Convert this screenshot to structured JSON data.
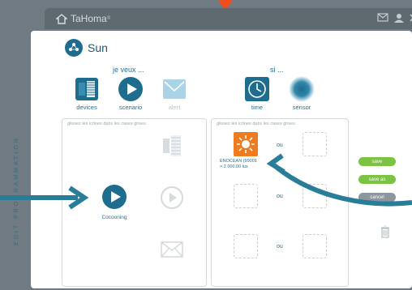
{
  "app": {
    "brand": "TaHoma",
    "registered": "®"
  },
  "dialog": {
    "title": "Sun",
    "if_label": "si ...",
    "want_label": "je veux ..."
  },
  "toolbar": [
    {
      "label": "devices",
      "icon": "devices-icon",
      "enabled": true
    },
    {
      "label": "scenario",
      "icon": "play-icon",
      "enabled": true
    },
    {
      "label": "alert",
      "icon": "mail-icon",
      "enabled": false
    },
    {
      "label": "time",
      "icon": "clock-icon",
      "enabled": true
    },
    {
      "label": "sensor",
      "icon": "sensor-icon",
      "enabled": true
    }
  ],
  "left_zone": {
    "hint": "glissez les icônes dans les cases grises",
    "item_label": "Cocooning"
  },
  "right_zone": {
    "hint": "glissez les icônes dans les cases grises",
    "sensor_name": "ENOCEAN (99001",
    "sensor_value": "> 2 000.00 lux",
    "or_labels": [
      "ou",
      "ou",
      "ou"
    ]
  },
  "side_label": "EDIT PROGRAMMATION",
  "buttons": {
    "save": "save",
    "save_as": "save as",
    "cancel": "cancel"
  },
  "colors": {
    "accent": "#1f6d8e",
    "green": "#7cc243",
    "grey": "#8c969c",
    "orange": "#f07a1e",
    "arrow": "#2a7d99"
  }
}
